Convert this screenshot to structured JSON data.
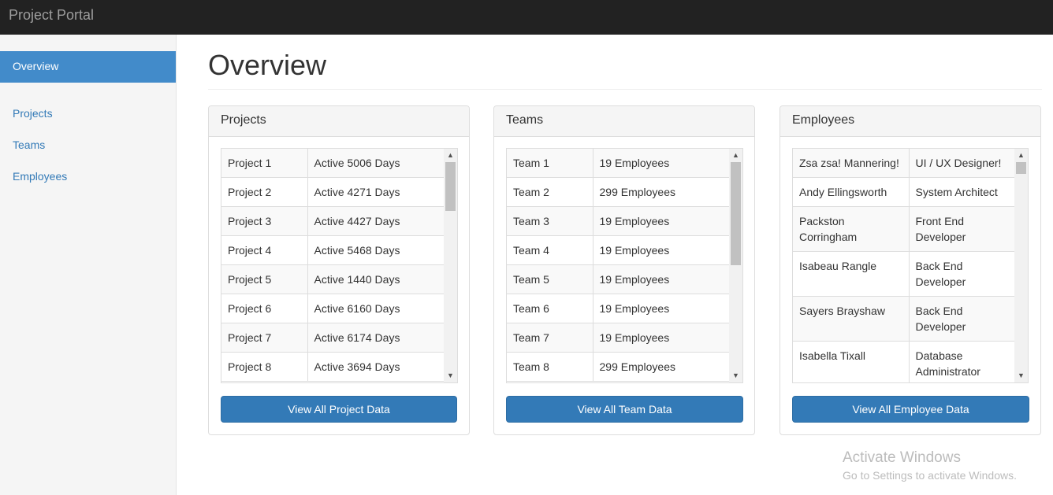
{
  "app": {
    "brand": "Project Portal"
  },
  "sidebar": {
    "items": [
      {
        "label": "Overview"
      },
      {
        "label": "Projects"
      },
      {
        "label": "Teams"
      },
      {
        "label": "Employees"
      }
    ]
  },
  "page": {
    "title": "Overview"
  },
  "panels": {
    "projects": {
      "heading": "Projects",
      "button": "View All Project Data",
      "rows": [
        [
          "Project 1",
          "Active 5006 Days"
        ],
        [
          "Project 2",
          "Active 4271 Days"
        ],
        [
          "Project 3",
          "Active 4427 Days"
        ],
        [
          "Project 4",
          "Active 5468 Days"
        ],
        [
          "Project 5",
          "Active 1440 Days"
        ],
        [
          "Project 6",
          "Active 6160 Days"
        ],
        [
          "Project 7",
          "Active 6174 Days"
        ],
        [
          "Project 8",
          "Active 3694 Days"
        ]
      ]
    },
    "teams": {
      "heading": "Teams",
      "button": "View All Team Data",
      "rows": [
        [
          "Team 1",
          "19 Employees"
        ],
        [
          "Team 2",
          "299 Employees"
        ],
        [
          "Team 3",
          "19 Employees"
        ],
        [
          "Team 4",
          "19 Employees"
        ],
        [
          "Team 5",
          "19 Employees"
        ],
        [
          "Team 6",
          "19 Employees"
        ],
        [
          "Team 7",
          "19 Employees"
        ],
        [
          "Team 8",
          "299 Employees"
        ]
      ]
    },
    "employees": {
      "heading": "Employees",
      "button": "View All Employee Data",
      "rows": [
        [
          "Zsa zsa! Mannering!",
          "UI / UX Designer!"
        ],
        [
          "Andy Ellingsworth",
          "System Architect"
        ],
        [
          "Packston Corringham",
          "Front End Developer"
        ],
        [
          "Isabeau Rangle",
          "Back End Developer"
        ],
        [
          "Sayers Brayshaw",
          "Back End Developer"
        ],
        [
          "Isabella Tixall",
          "Database Administrator"
        ]
      ]
    }
  },
  "watermark": {
    "title": "Activate Windows",
    "subtitle": "Go to Settings to activate Windows."
  }
}
